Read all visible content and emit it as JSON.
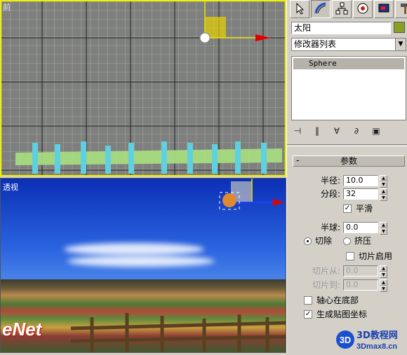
{
  "front_viewport": {
    "label": "前"
  },
  "perspective_viewport": {
    "label": "透视",
    "watermark": "eNet"
  },
  "command_panel": {
    "tabs": [
      {
        "icon": "create-arrow-icon"
      },
      {
        "icon": "modify-arc-icon"
      },
      {
        "icon": "hierarchy-icon"
      },
      {
        "icon": "motion-icon"
      },
      {
        "icon": "display-icon"
      },
      {
        "icon": "utilities-hammer-icon"
      }
    ],
    "object_name": "太阳",
    "object_color": "#8aa024",
    "modifier_list": "修改器列表",
    "stack_items": [
      "Sphere"
    ],
    "params": {
      "title": "参数",
      "radius_label": "半径:",
      "radius_value": "10.0",
      "segments_label": "分段:",
      "segments_value": "32",
      "smooth_label": "平滑",
      "smooth_checked": true,
      "hemisphere_label": "半球:",
      "hemisphere_value": "0.0",
      "chop_label": "切除",
      "squash_label": "挤压",
      "slice_on_label": "切片启用",
      "slice_from_label": "切片从:",
      "slice_from_value": "0.0",
      "slice_to_label": "切片到:",
      "slice_to_value": "0.0",
      "base_to_pivot_label": "轴心在底部",
      "gen_mapping_label": "生成贴图坐标"
    },
    "logo": {
      "line1": "3D教程网",
      "line2": "3Dmax8.cn"
    }
  }
}
